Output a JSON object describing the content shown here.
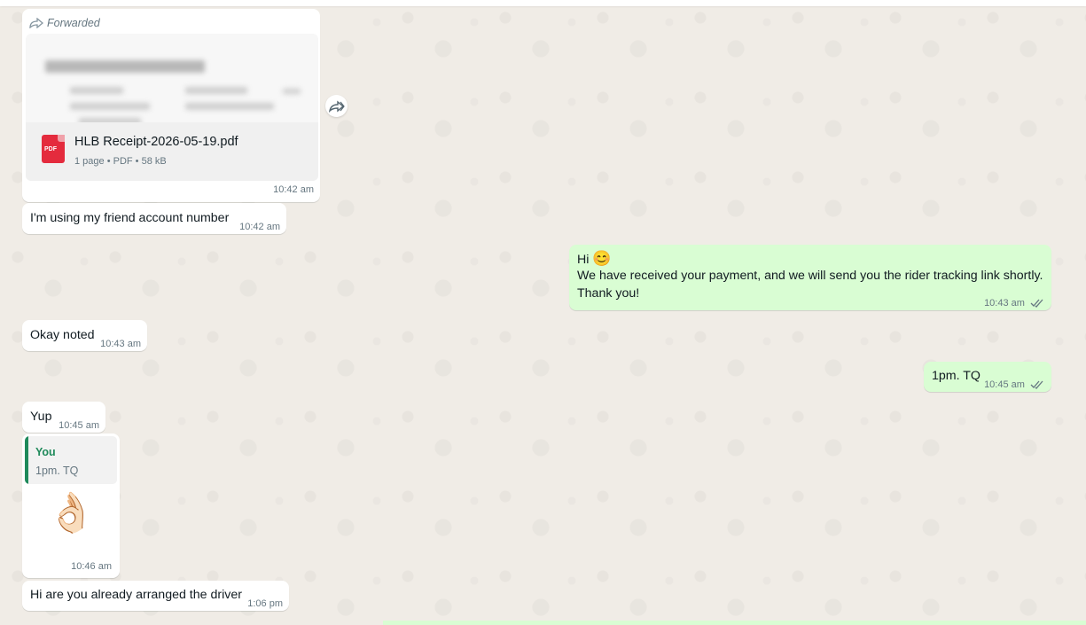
{
  "chat": {
    "forwarded_doc": {
      "forwarded_label": "Forwarded",
      "file_name": "HLB Receipt-2026-05-19.pdf",
      "file_meta": "1 page • PDF • 58 kB",
      "file_badge": "PDF",
      "time": "10:42 am"
    },
    "messages": [
      {
        "id": "m1",
        "text": "I'm using my friend account number",
        "time": "10:42 am"
      },
      {
        "id": "m2",
        "line1": "Hi",
        "emoji": "😊",
        "line2": "We have received your payment, and we will send you the rider tracking link shortly.",
        "line3": "Thank you!",
        "time": "10:43 am"
      },
      {
        "id": "m3",
        "text": "Okay noted",
        "time": "10:43 am"
      },
      {
        "id": "m4",
        "text": "1pm. TQ",
        "time": "10:45 am"
      },
      {
        "id": "m5",
        "text": "Yup",
        "time": "10:45 am"
      },
      {
        "id": "m6",
        "quote_author": "You",
        "quote_text": "1pm. TQ",
        "emoji": "👌🏻",
        "time": "10:46 am"
      },
      {
        "id": "m7",
        "text": "Hi are you already arranged the driver",
        "time": "1:06 pm"
      }
    ]
  },
  "icons": {
    "forward": "forward-arrow-icon",
    "share": "share-forward-icon",
    "ticks": "double-check-icon",
    "pdf": "pdf-file-icon"
  },
  "colors": {
    "incoming_bubble": "#ffffff",
    "outgoing_bubble": "#d9fdd3",
    "read_ticks": "#667781",
    "quote_accent": "#1f8a5b"
  }
}
